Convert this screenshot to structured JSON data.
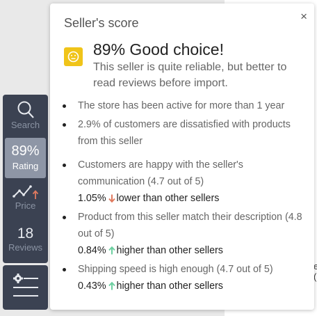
{
  "popup": {
    "title": "Seller's score",
    "close_label": "×",
    "headline": "89% Good choice!",
    "subtext": "This seller is quite reliable, but better to read reviews before import.",
    "facts": [
      {
        "text": "The store has been active for more than 1 year"
      },
      {
        "text": "2.9% of customers are dissatisfied with products from this seller"
      },
      {
        "text": "Customers are happy with the seller's communication (4.7 out of 5)",
        "compare_value": "1.05%",
        "compare_text": "lower than other sellers",
        "direction": "down"
      },
      {
        "text": "Product from this seller match their description (4.8 out of 5)",
        "compare_value": "0.84%",
        "compare_text": "higher than other sellers",
        "direction": "up"
      },
      {
        "text": "Shipping speed is high enough (4.7 out of 5)",
        "compare_value": "0.43%",
        "compare_text": "higher than other sellers",
        "direction": "up"
      }
    ]
  },
  "sidebar": {
    "search_label": "Search",
    "rating_value": "89%",
    "rating_label": "Rating",
    "price_label": "Price",
    "reviews_count": "18",
    "reviews_label": "Reviews"
  },
  "background": {
    "edge_char_1": "e",
    "edge_char_2": "("
  },
  "colors": {
    "down_arrow": "#e07a5f",
    "up_arrow": "#6ccfa0",
    "face_icon": "#f0c419",
    "rail_bg": "#3b4252",
    "rating_active_bg": "#8e96a6"
  },
  "icons": {
    "search": "search-icon",
    "price": "price-trend-icon",
    "settings": "settings-icon",
    "face": "neutral-face-icon"
  }
}
